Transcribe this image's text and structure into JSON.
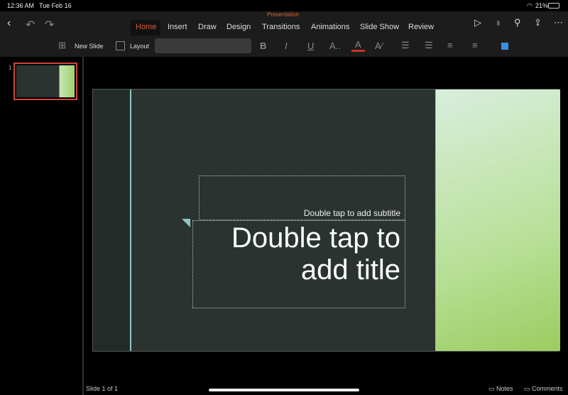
{
  "status": {
    "time": "12:36 AM",
    "date": "Tue Feb 16",
    "battery": "21%"
  },
  "title": "Presentation",
  "tabs": [
    "Home",
    "Insert",
    "Draw",
    "Design",
    "Transitions",
    "Animations",
    "Slide Show",
    "Review"
  ],
  "toolbar": {
    "new_slide": "New Slide",
    "layout": "Layout",
    "bold": "B",
    "italic": "I",
    "underline": "U",
    "font_size": "A..",
    "font_color": "A",
    "accent": "#c8322b"
  },
  "thumb": {
    "number": "1"
  },
  "slide": {
    "subtitle": "Double tap to add subtitle",
    "title": "Double tap to add title"
  },
  "bottom": {
    "slide_count": "Slide 1 of 1",
    "notes": "Notes",
    "comments": "Comments"
  }
}
